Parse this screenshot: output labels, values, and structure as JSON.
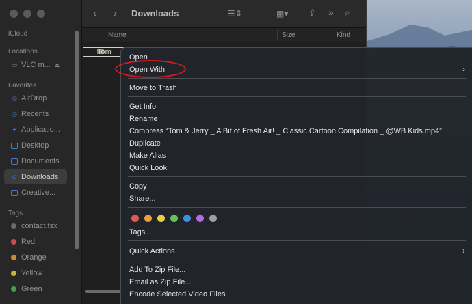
{
  "toolbar": {
    "title": "Downloads",
    "back_icon": "chevron-left-icon",
    "forward_icon": "chevron-right-icon"
  },
  "sidebar": {
    "sections": {
      "icloud": "iCloud",
      "locations": "Locations",
      "favorites": "Favorites",
      "tags": "Tags"
    },
    "locations": [
      {
        "label": "VLC m...",
        "icon": "disk-icon"
      }
    ],
    "favorites": [
      {
        "label": "AirDrop",
        "icon": "airdrop-icon"
      },
      {
        "label": "Recents",
        "icon": "clock-icon"
      },
      {
        "label": "Applicatio...",
        "icon": "applications-icon"
      },
      {
        "label": "Desktop",
        "icon": "desktop-icon"
      },
      {
        "label": "Documents",
        "icon": "document-icon"
      },
      {
        "label": "Downloads",
        "icon": "download-icon",
        "active": true
      },
      {
        "label": "Creative...",
        "icon": "folder-icon"
      }
    ],
    "tags": [
      {
        "label": "contact.tsx",
        "color": "#6b6b6b"
      },
      {
        "label": "Red",
        "color": "#c94a4a"
      },
      {
        "label": "Orange",
        "color": "#d08a2e"
      },
      {
        "label": "Yellow",
        "color": "#c9b23a"
      },
      {
        "label": "Green",
        "color": "#4aa04a"
      }
    ]
  },
  "columns": {
    "name": "Name",
    "size": "Size",
    "kind": "Kind"
  },
  "file": {
    "name": "Tom"
  },
  "menu": {
    "open": "Open",
    "open_with": "Open With",
    "move_to_trash": "Move to Trash",
    "get_info": "Get Info",
    "rename": "Rename",
    "compress": "Compress “Tom & Jerry _ A Bit of Fresh Air! _ Classic Cartoon Compilation _ @WB Kids.mp4”",
    "duplicate": "Duplicate",
    "make_alias": "Make Alias",
    "quick_look": "Quick Look",
    "copy": "Copy",
    "share": "Share...",
    "tags": "Tags...",
    "quick_actions": "Quick Actions",
    "add_to_zip": "Add To Zip File...",
    "email_zip": "Email as Zip File...",
    "encode_video": "Encode Selected Video Files",
    "tag_colors": [
      "#e05a52",
      "#e9a23b",
      "#e8cf3d",
      "#5ec453",
      "#3f8de6",
      "#b56ae0",
      "#a0a0a0"
    ],
    "annotation_color": "#d31d1d"
  }
}
